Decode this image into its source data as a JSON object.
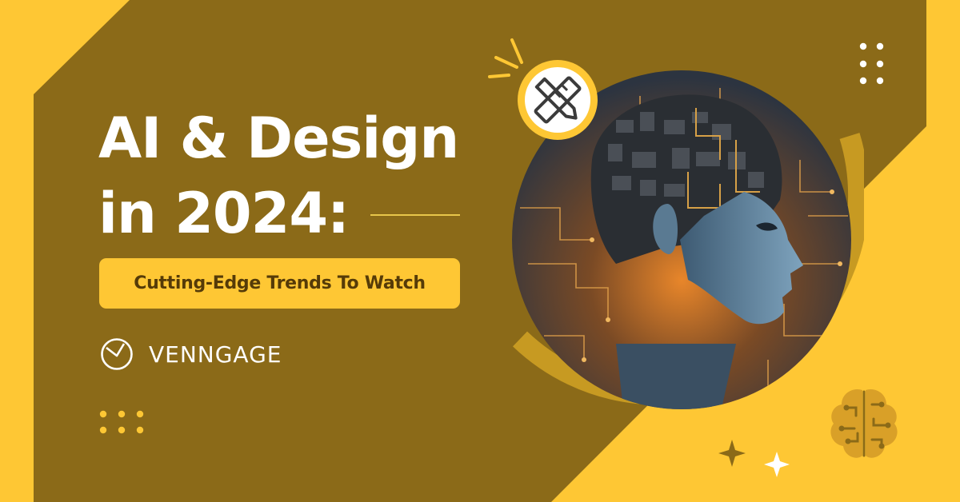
{
  "banner": {
    "title_line1": "AI & Design",
    "title_line2": "in 2024:",
    "subtitle": "Cutting-Edge Trends To Watch",
    "brand": "VENNGAGE"
  },
  "icons": {
    "badge": "ruler-pencil-icon",
    "brain": "brain-circuit-icon",
    "sparkles": "sparkle-icon",
    "dots": "dot-grid-icon",
    "logo": "venngage-logo-icon"
  },
  "colors": {
    "background_dark": "#8b6a18",
    "accent_yellow": "#fec734",
    "white": "#ffffff",
    "subtitle_text": "#553b08"
  }
}
